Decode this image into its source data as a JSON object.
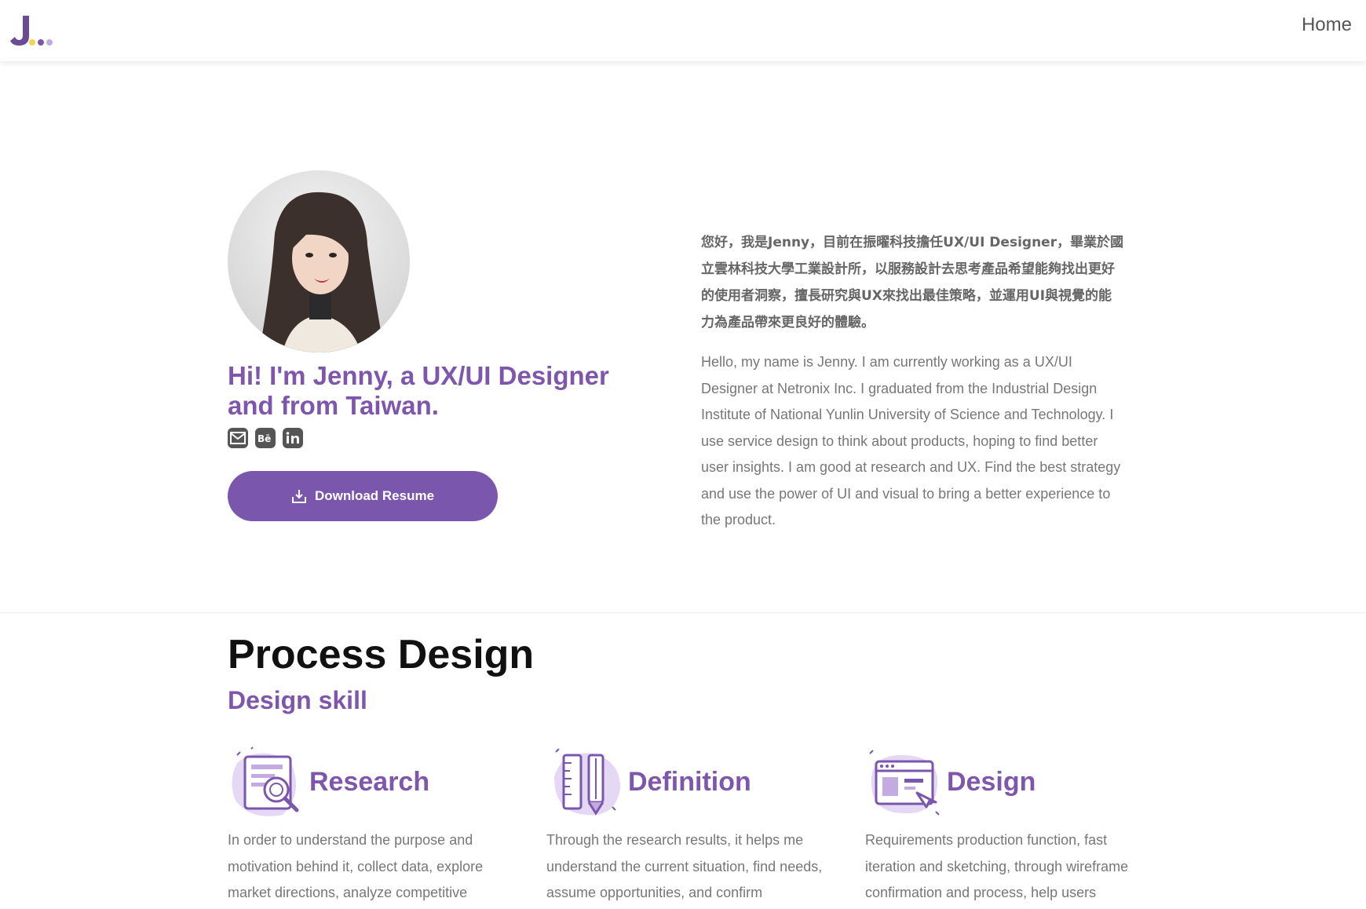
{
  "nav": {
    "home_label": "Home"
  },
  "hero": {
    "title": "Hi! I'm Jenny, a UX/UI Designer and from Taiwan.",
    "download_label": "Download Resume",
    "bio_zh": "您好，我是Jenny，目前在振曜科技擔任UX/UI Designer，畢業於國立雲林科技大學工業設計所，以服務設計去思考產品希望能夠找出更好的使用者洞察，擅長研究與UX來找出最佳策略，並運用UI與視覺的能力為產品帶來更良好的體驗。",
    "bio_en": "Hello, my name is Jenny. I am currently working as a UX/UI Designer at Netronix Inc. I graduated from the Industrial Design Institute of National Yunlin University of Science and Technology. I use service design to think about products, hoping to find better user insights. I am good at research and UX. Find the best strategy and use the power of UI and visual to bring a better experience to the product.",
    "socials": [
      "mail-icon",
      "behance-icon",
      "linkedin-icon"
    ]
  },
  "process": {
    "title": "Process Design",
    "subtitle": "Design skill",
    "cards": [
      {
        "title": "Research",
        "desc": "In order to understand the purpose and motivation behind it, collect data, explore market directions, analyze competitive",
        "icon": "research-icon"
      },
      {
        "title": "Definition",
        "desc": "Through the research results, it helps me understand the current situation, find needs, assume opportunities, and confirm",
        "icon": "ruler-pencil-icon"
      },
      {
        "title": "Design",
        "desc": "Requirements production function, fast iteration and sketching, through wireframe confirmation and process, help users",
        "icon": "design-window-icon"
      }
    ]
  },
  "colors": {
    "accent": "#7b56ad",
    "accent_light": "#d9c9ef",
    "logo_yellow": "#f2d64b"
  }
}
